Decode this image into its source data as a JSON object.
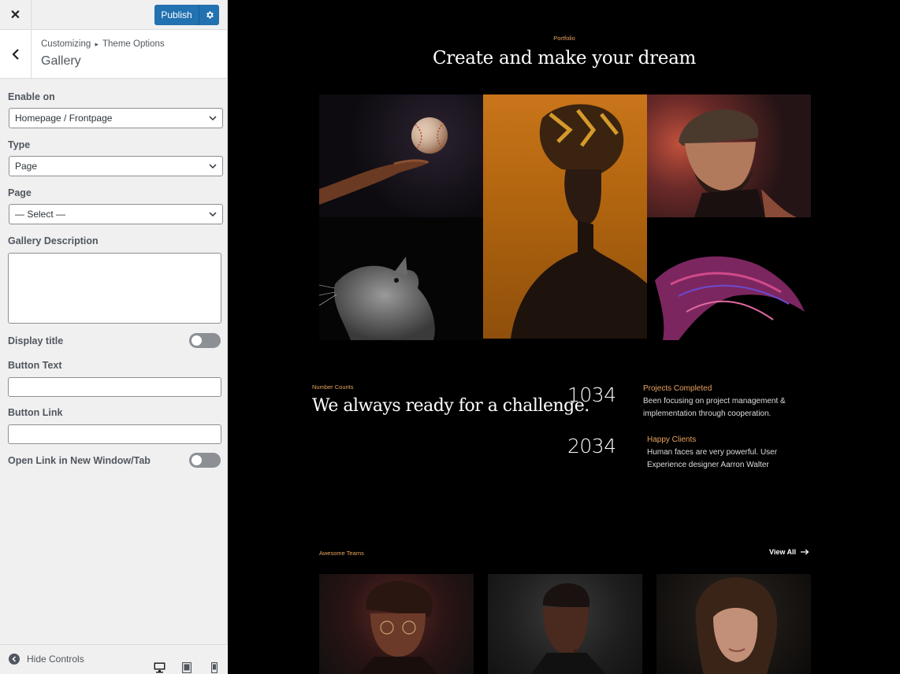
{
  "customizer": {
    "publish_label": "Publish",
    "breadcrumb_root": "Customizing",
    "breadcrumb_separator": "▸",
    "breadcrumb_parent": "Theme Options",
    "section_title": "Gallery",
    "controls": {
      "enable_on": {
        "label": "Enable on",
        "value": "Homepage / Frontpage"
      },
      "type": {
        "label": "Type",
        "value": "Page"
      },
      "page": {
        "label": "Page",
        "value": "— Select —"
      },
      "gallery_description": {
        "label": "Gallery Description",
        "value": ""
      },
      "display_title": {
        "label": "Display title",
        "enabled": false
      },
      "button_text": {
        "label": "Button Text",
        "value": ""
      },
      "button_link": {
        "label": "Button Link",
        "value": ""
      },
      "open_new_tab": {
        "label": "Open Link in New Window/Tab",
        "enabled": false
      }
    },
    "footer": {
      "hide_controls_label": "Hide Controls"
    },
    "accent_color": "#2271b1"
  },
  "preview": {
    "portfolio": {
      "kicker": "Portfolio",
      "title": "Create and make your dream"
    },
    "number_counts": {
      "kicker": "Number Counts",
      "title": "We always ready for a challenge.",
      "stats": [
        {
          "number": "1034",
          "title": "Projects Completed",
          "desc_line1": "Been focusing on project management &",
          "desc_line2": "implementation through cooperation."
        },
        {
          "number": "2034",
          "title": "Happy Clients",
          "desc_line1": "Human faces are very powerful. User",
          "desc_line2": "Experience designer Aarron Walter"
        }
      ]
    },
    "teams": {
      "kicker": "Awesome Teams",
      "view_all": "View All"
    },
    "accent_color": "#e8a35d"
  }
}
